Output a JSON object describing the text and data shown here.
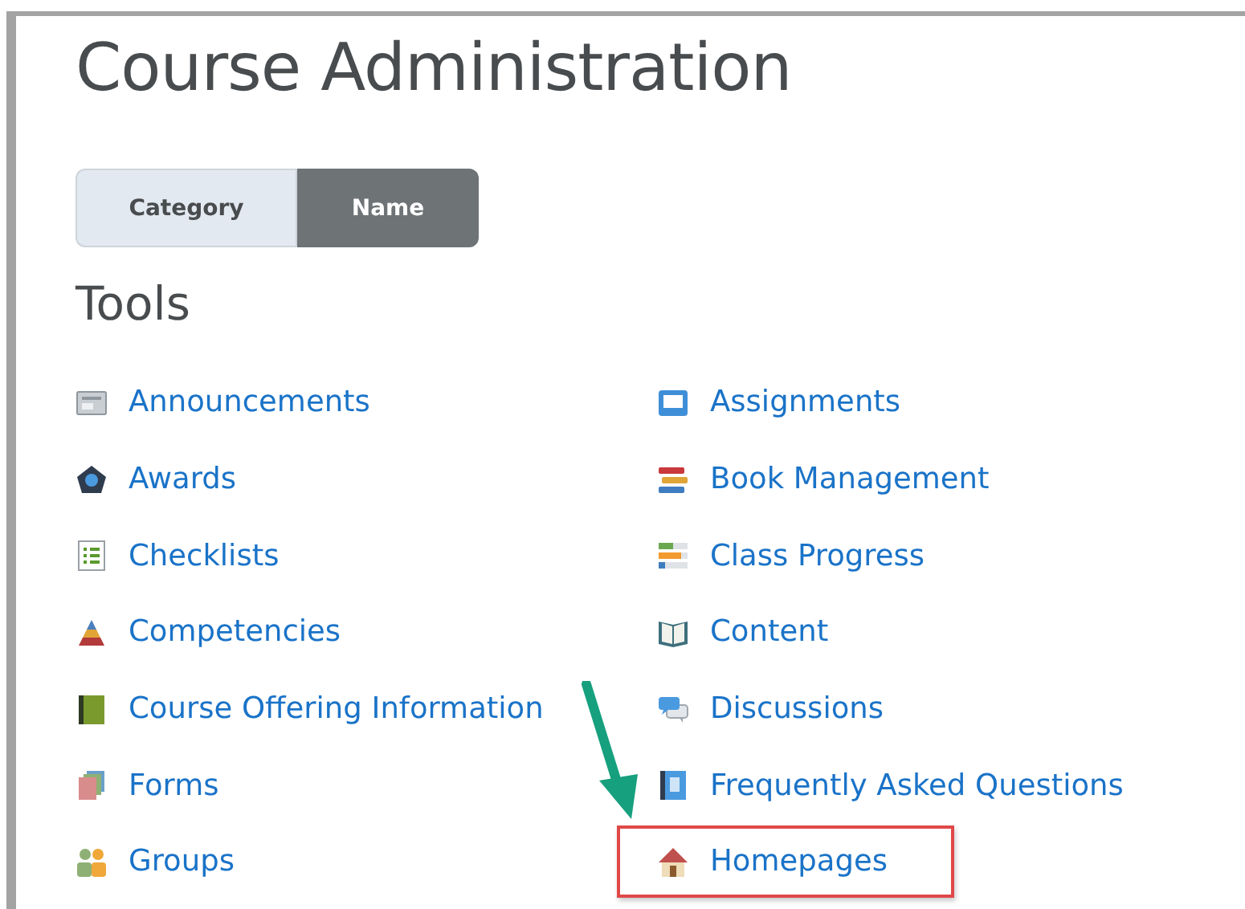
{
  "page": {
    "title": "Course Administration"
  },
  "view_toggle": [
    {
      "label": "Category",
      "selected": false
    },
    {
      "label": "Name",
      "selected": true
    }
  ],
  "section": {
    "title": "Tools"
  },
  "tools": [
    {
      "label": "Announcements",
      "highlighted": false
    },
    {
      "label": "Assignments",
      "highlighted": false
    },
    {
      "label": "Awards",
      "highlighted": false
    },
    {
      "label": "Book Management",
      "highlighted": false
    },
    {
      "label": "Checklists",
      "highlighted": false
    },
    {
      "label": "Class Progress",
      "highlighted": false
    },
    {
      "label": "Competencies",
      "highlighted": false
    },
    {
      "label": "Content",
      "highlighted": false
    },
    {
      "label": "Course Offering Information",
      "highlighted": false
    },
    {
      "label": "Discussions",
      "highlighted": false
    },
    {
      "label": "Forms",
      "highlighted": false
    },
    {
      "label": "Frequently Asked Questions",
      "highlighted": false
    },
    {
      "label": "Groups",
      "highlighted": false
    },
    {
      "label": "Homepages",
      "highlighted": true
    }
  ]
}
